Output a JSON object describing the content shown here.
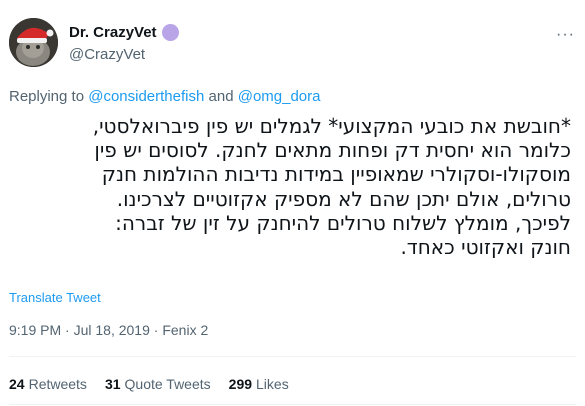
{
  "author": {
    "display_name": "Dr. CrazyVet",
    "handle": "@CrazyVet",
    "avatar_icon": "avatar-cat-santa-hat",
    "badge_icon": "purple-circle-emoji"
  },
  "more_icon": "more-horizontal-icon",
  "replying": {
    "prefix": "Replying to ",
    "mention_1": "@considerthefish",
    "joiner": " and ",
    "mention_2": "@omg_dora"
  },
  "tweet_lines": [
    "*חובשת את כובעי המקצועי* לגמלים יש פין פיברואלסטי,",
    "כלומר הוא יחסית דק ופחות מתאים לחנק. לסוסים יש פין",
    "מוסקולו-וסקולרי שמאופיין במידות נדיבות ההולמות חנק",
    "טרולים, אולם יתכן שהם לא מספיק אקזוטיים לצרכינו.",
    "לפיכך, מומלץ לשלוח טרולים להיחנק על זין של זברה:",
    "חונק ואקזוטי כאחד."
  ],
  "translate_label": "Translate Tweet",
  "meta": {
    "time": "9:19 PM",
    "separator": " · ",
    "date": "Jul 18, 2019",
    "source": "Fenix 2"
  },
  "stats": {
    "retweets_count": "24",
    "retweets_label": "Retweets",
    "quotes_count": "31",
    "quotes_label": "Quote Tweets",
    "likes_count": "299",
    "likes_label": "Likes"
  },
  "colors": {
    "link": "#1d9bf0",
    "secondary_text": "#536471",
    "primary_text": "#0f1419",
    "badge": "#b9a4e8"
  }
}
